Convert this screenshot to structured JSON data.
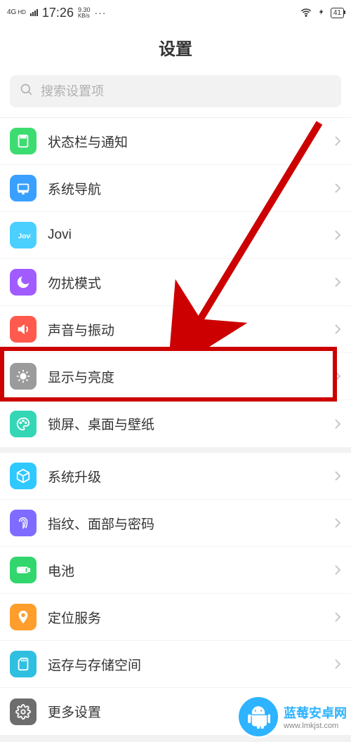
{
  "status_bar": {
    "network_type": "4G",
    "network_hd": "HD",
    "time": "17:26",
    "net_speed_value": "9.30",
    "net_speed_unit": "KB/s",
    "more_dots": "···",
    "bolt": "⧋",
    "battery_percent": "41"
  },
  "header": {
    "title": "设置"
  },
  "search": {
    "placeholder": "搜索设置项"
  },
  "groups": [
    {
      "items": [
        {
          "key": "status-notif",
          "label": "状态栏与通知",
          "icon": "status-icon",
          "color": "#3ddc71"
        },
        {
          "key": "system-nav",
          "label": "系统导航",
          "icon": "nav-icon",
          "color": "#3aa0ff"
        },
        {
          "key": "jovi",
          "label": "Jovi",
          "icon": "jovi-icon",
          "color": "#4acfff"
        },
        {
          "key": "dnd",
          "label": "勿扰模式",
          "icon": "moon-icon",
          "color": "#a05cff"
        },
        {
          "key": "sound",
          "label": "声音与振动",
          "icon": "speaker-icon",
          "color": "#ff5a4d"
        },
        {
          "key": "display",
          "label": "显示与亮度",
          "icon": "brightness-icon",
          "color": "#9b9b9b"
        },
        {
          "key": "lock-desktop",
          "label": "锁屏、桌面与壁纸",
          "icon": "palette-icon",
          "color": "#33d6b5"
        }
      ]
    },
    {
      "items": [
        {
          "key": "system-update",
          "label": "系统升级",
          "icon": "cube-icon",
          "color": "#2fc8ff"
        },
        {
          "key": "biometrics",
          "label": "指纹、面部与密码",
          "icon": "fingerprint-icon",
          "color": "#7f6bff"
        },
        {
          "key": "battery",
          "label": "电池",
          "icon": "battery-icon",
          "color": "#31d66d"
        },
        {
          "key": "location",
          "label": "定位服务",
          "icon": "location-icon",
          "color": "#ff9e2c"
        },
        {
          "key": "storage",
          "label": "运存与存储空间",
          "icon": "sdcard-icon",
          "color": "#2fbfe0"
        },
        {
          "key": "more",
          "label": "更多设置",
          "icon": "gear-icon",
          "color": "#6d6d6d"
        }
      ]
    }
  ],
  "watermark": {
    "title": "蓝莓安卓网",
    "url": "www.lmkjst.com"
  }
}
